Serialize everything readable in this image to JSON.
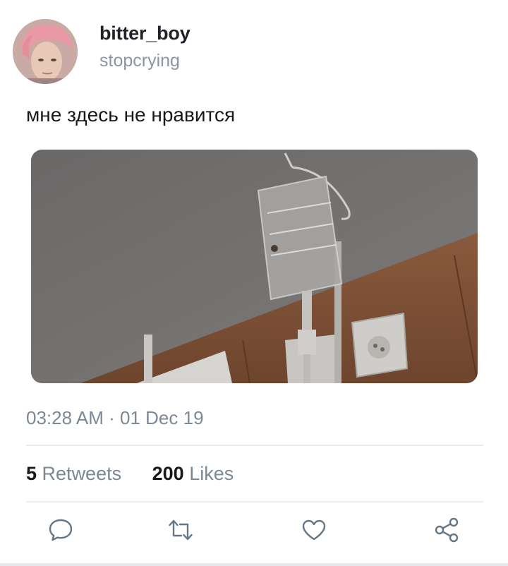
{
  "tweet": {
    "display_name": "bitter_boy",
    "username": "stopcrying",
    "text": "мне здесь не нравится",
    "time": "03:28 AM",
    "separator": "·",
    "date": "01 Dec 19"
  },
  "stats": {
    "retweets_count": "5",
    "retweets_label": "Retweets",
    "likes_count": "200",
    "likes_label": "Likes"
  },
  "actions": {
    "reply_icon": "comment-icon",
    "retweet_icon": "retweet-icon",
    "like_icon": "heart-icon",
    "share_icon": "share-icon"
  },
  "colors": {
    "icon": "#657786",
    "secondary_text": "#7d8895",
    "primary_text": "#16191c"
  }
}
